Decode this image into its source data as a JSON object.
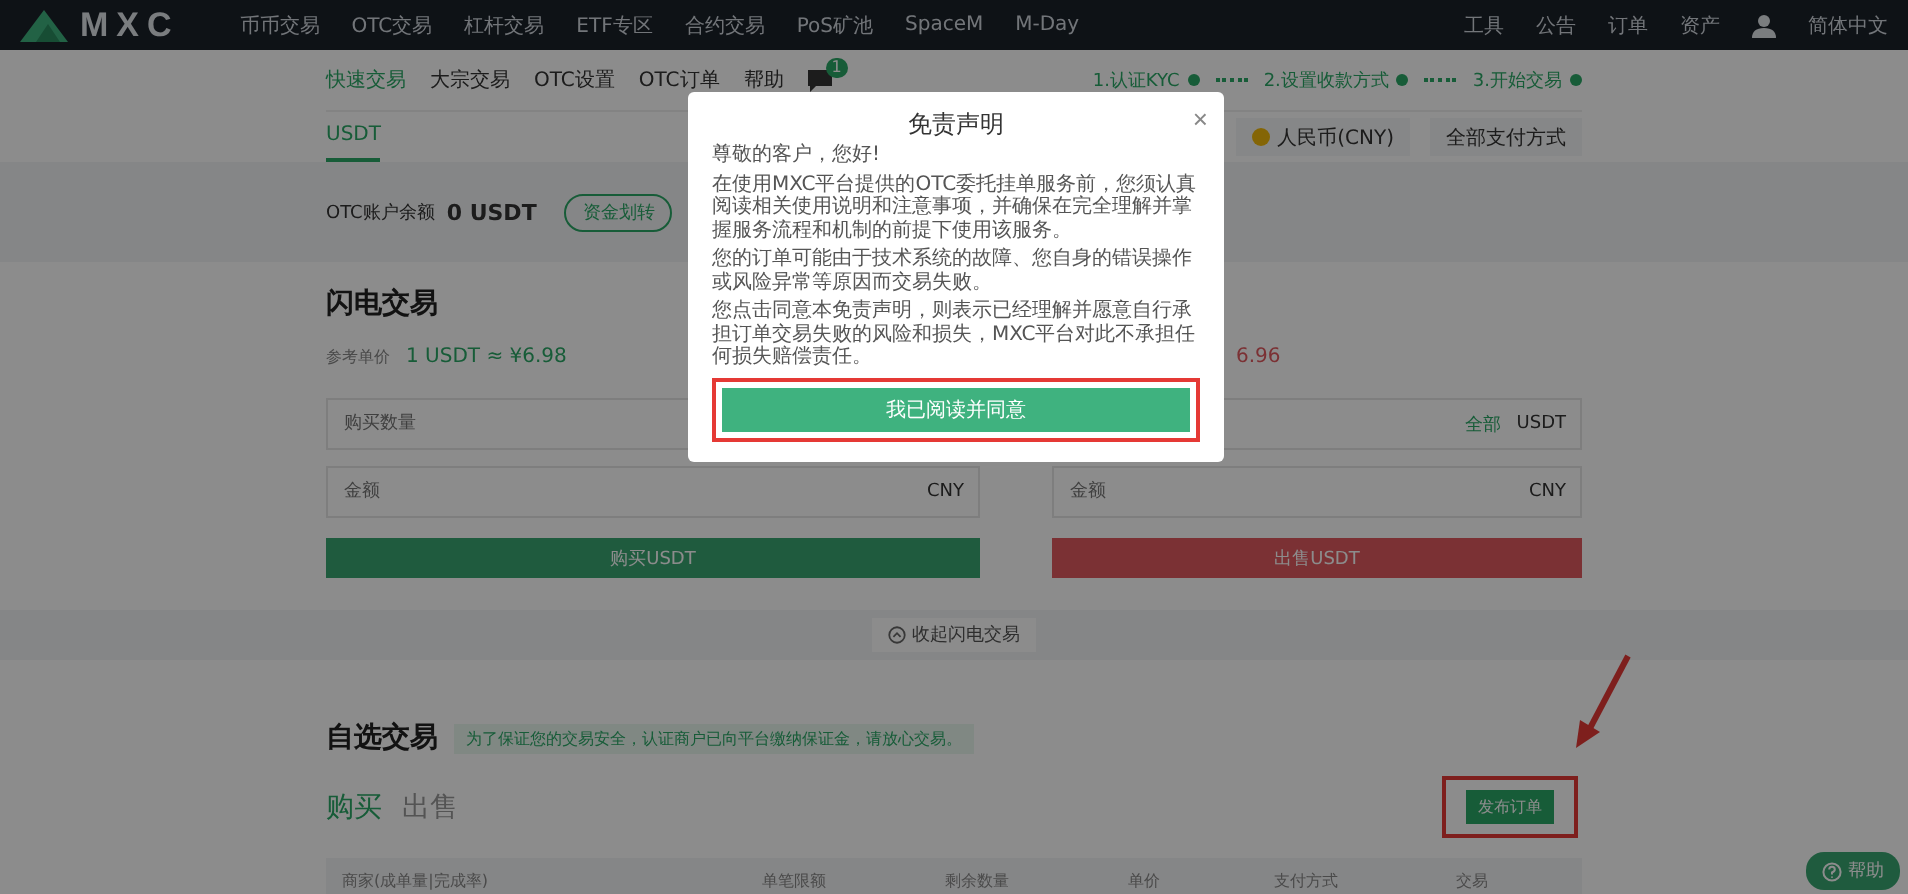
{
  "top_nav": {
    "logo": "MXC",
    "items": [
      "币币交易",
      "OTC交易",
      "杠杆交易",
      "ETF专区",
      "合约交易",
      "PoS矿池",
      "SpaceM",
      "M-Day"
    ],
    "right_items": [
      "工具",
      "公告",
      "订单",
      "资产"
    ],
    "language": "简体中文"
  },
  "sub_nav": {
    "items": [
      {
        "label": "快速交易",
        "selected": true
      },
      {
        "label": "大宗交易",
        "selected": false
      },
      {
        "label": "OTC设置",
        "selected": false
      },
      {
        "label": "OTC订单",
        "selected": false
      },
      {
        "label": "帮助",
        "selected": false
      }
    ],
    "badge": "1",
    "steps": [
      "1.认证KYC",
      "2.设置收款方式",
      "3.开始交易"
    ]
  },
  "currency_tabs": [
    {
      "label": "USDT",
      "selected": true
    }
  ],
  "fiat_select": "人民币(CNY)",
  "payment_select": "全部支付方式",
  "balance": {
    "label": "OTC账户余额",
    "value": "0 USDT",
    "button": "资金划转"
  },
  "flash": {
    "title": "闪电交易",
    "ref_label": "参考单价",
    "buy_price": "1 USDT ≈ ¥6.98",
    "sell_price": "6.96",
    "buy": {
      "qty_placeholder": "购买数量",
      "amount_placeholder": "金额",
      "amount_unit": "CNY",
      "button": "购买USDT"
    },
    "sell": {
      "all_link": "全部",
      "qty_unit": "USDT",
      "amount_placeholder": "金额",
      "amount_unit": "CNY",
      "button": "出售USDT"
    },
    "collapse": "收起闪电交易"
  },
  "custom": {
    "title": "自选交易",
    "notice": "为了保证您的交易安全，认证商户已向平台缴纳保证金，请放心交易。",
    "tabs": [
      {
        "label": "购买",
        "selected": true
      },
      {
        "label": "出售",
        "selected": false
      }
    ],
    "publish_button": "发布订单",
    "columns": [
      "商家(成单量|完成率)",
      "单笔限额",
      "剩余数量",
      "单价",
      "支付方式",
      "交易"
    ]
  },
  "help_button": "帮助",
  "modal": {
    "title": "免责声明",
    "close": "×",
    "paragraphs": [
      "尊敬的客户，您好!",
      "在使用MXC平台提供的OTC委托挂单服务前，您须认真阅读相关使用说明和注意事项，并确保在完全理解并掌握服务流程和机制的前提下使用该服务。",
      "您的订单可能由于技术系统的故障、您自身的错误操作或风险异常等原因而交易失败。",
      "您点击同意本免责声明，则表示已经理解并愿意自行承担订单交易失败的风险和损失，MXC平台对此不承担任何损失赔偿责任。"
    ],
    "button": "我已阅读并同意"
  }
}
